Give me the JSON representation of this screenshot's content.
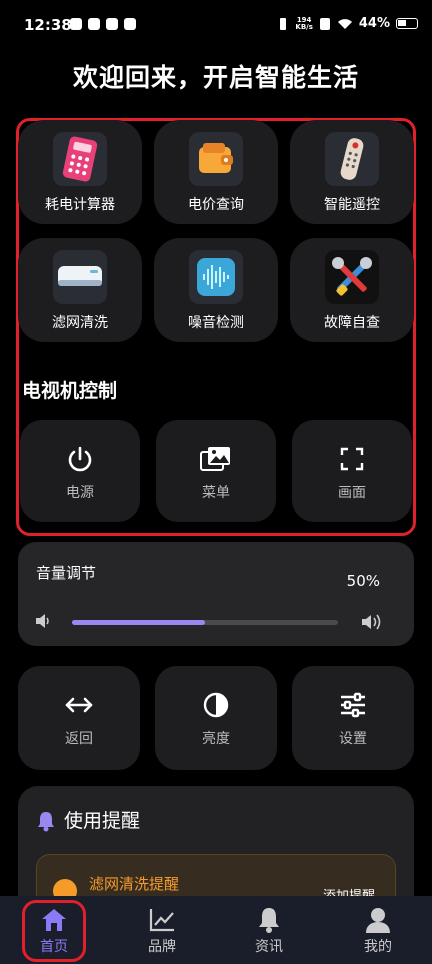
{
  "status_bar": {
    "time": "12:38",
    "net_speed_value": "194",
    "net_speed_unit": "KB/s",
    "battery": "44%"
  },
  "header": {
    "title": "欢迎回来，开启智能生活"
  },
  "tools": [
    {
      "label": "耗电计算器",
      "icon": "calculator-icon"
    },
    {
      "label": "电价查询",
      "icon": "wallet-icon"
    },
    {
      "label": "智能遥控",
      "icon": "remote-control-icon"
    },
    {
      "label": "滤网清洗",
      "icon": "air-conditioner-icon"
    },
    {
      "label": "噪音检测",
      "icon": "sound-wave-icon"
    },
    {
      "label": "故障自查",
      "icon": "tools-icon"
    }
  ],
  "tv_control": {
    "title": "电视机控制",
    "buttons": [
      {
        "label": "电源",
        "icon": "power-icon"
      },
      {
        "label": "菜单",
        "icon": "photos-icon"
      },
      {
        "label": "画面",
        "icon": "fullscreen-icon"
      }
    ]
  },
  "volume": {
    "title": "音量调节",
    "percent_label": "50%",
    "level": 0.5
  },
  "controls": [
    {
      "label": "返回",
      "icon": "left-right-arrow-icon"
    },
    {
      "label": "亮度",
      "icon": "contrast-icon"
    },
    {
      "label": "设置",
      "icon": "sliders-icon"
    }
  ],
  "reminders": {
    "title": "使用提醒",
    "alert_title": "滤网清洗提醒",
    "alert_action": "添加提醒"
  },
  "nav": [
    {
      "label": "首页",
      "icon": "home-icon",
      "active": true
    },
    {
      "label": "品牌",
      "icon": "chart-icon",
      "active": false
    },
    {
      "label": "资讯",
      "icon": "bell-icon",
      "active": false
    },
    {
      "label": "我的",
      "icon": "user-icon",
      "active": false
    }
  ],
  "colors": {
    "accent": "#9b87f0",
    "highlight_border": "#e0202a",
    "warning": "#f59b2a"
  }
}
